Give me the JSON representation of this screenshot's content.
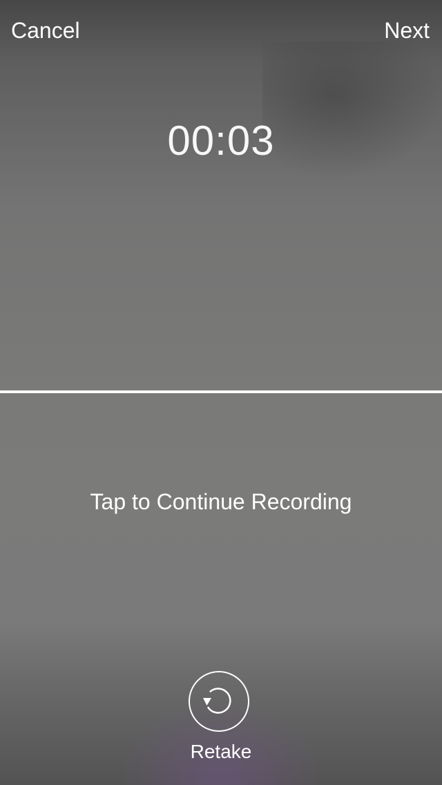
{
  "nav": {
    "cancel_label": "Cancel",
    "next_label": "Next"
  },
  "recording": {
    "timer": "00:03",
    "prompt": "Tap to Continue Recording"
  },
  "retake": {
    "icon": "retake-icon",
    "label": "Retake"
  }
}
